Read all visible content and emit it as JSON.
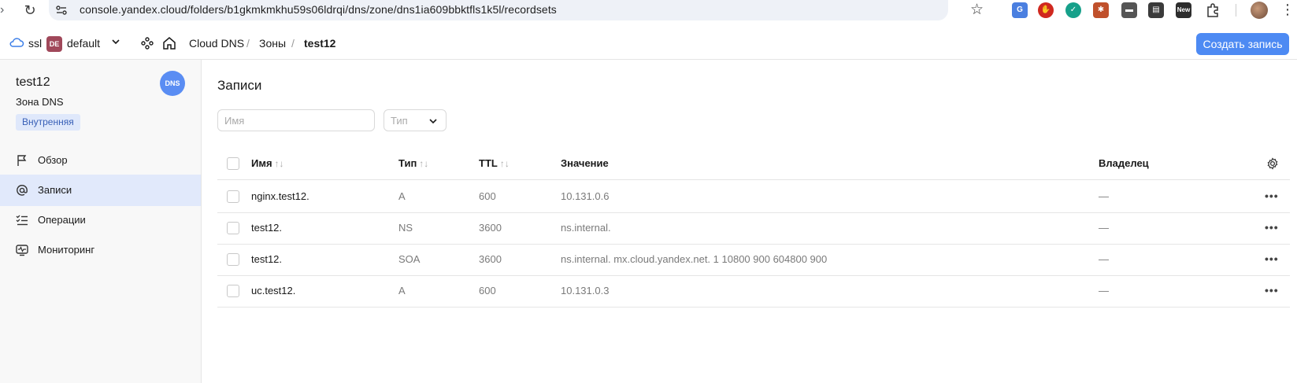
{
  "browser": {
    "url": "console.yandex.cloud/folders/b1gkmkmkhu59s06ldrqi/dns/zone/dns1ia609bbktfls1k5l/recordsets",
    "extensions": [
      {
        "name": "translate-extension-icon",
        "color": "#4a7fe0",
        "label": "G"
      },
      {
        "name": "adblock-extension-icon",
        "color": "#d0281f",
        "label": "✋"
      },
      {
        "name": "shield-extension-icon",
        "color": "#16a08a",
        "label": "✓"
      },
      {
        "name": "bug-extension-icon",
        "color": "#c0502b",
        "label": "✱"
      },
      {
        "name": "hat-extension-icon",
        "color": "#555555",
        "label": "▬"
      },
      {
        "name": "news-extension-icon",
        "color": "#3b3b3b",
        "label": "▤"
      },
      {
        "name": "new-extension-icon",
        "color": "#2d2d2d",
        "label": "New"
      }
    ]
  },
  "header": {
    "cloud_label": "ssl",
    "folder_badge": "DE",
    "folder_label": "default",
    "breadcrumbs": [
      "Cloud DNS",
      "Зоны",
      "test12"
    ],
    "create_button": "Создать запись"
  },
  "sidebar": {
    "zone_name": "test12",
    "zone_type": "Зона DNS",
    "zone_badge": "Внутренняя",
    "avatar": "DNS",
    "items": [
      {
        "label": "Обзор",
        "icon": "flag-icon"
      },
      {
        "label": "Записи",
        "icon": "at-icon",
        "active": true
      },
      {
        "label": "Операции",
        "icon": "checklist-icon"
      },
      {
        "label": "Мониторинг",
        "icon": "monitor-icon"
      }
    ]
  },
  "main": {
    "title": "Записи",
    "name_placeholder": "Имя",
    "type_placeholder": "Тип",
    "columns": {
      "name": "Имя",
      "type": "Тип",
      "ttl": "TTL",
      "value": "Значение",
      "owner": "Владелец"
    },
    "sort_glyph": "↑↓",
    "rows": [
      {
        "name": "nginx.test12.",
        "type": "A",
        "ttl": "600",
        "value": "10.131.0.6",
        "owner": "—"
      },
      {
        "name": "test12.",
        "type": "NS",
        "ttl": "3600",
        "value": "ns.internal.",
        "owner": "—"
      },
      {
        "name": "test12.",
        "type": "SOA",
        "ttl": "3600",
        "value": "ns.internal. mx.cloud.yandex.net. 1 10800 900 604800 900",
        "owner": "—"
      },
      {
        "name": "uc.test12.",
        "type": "A",
        "ttl": "600",
        "value": "10.131.0.3",
        "owner": "—"
      }
    ],
    "row_menu": "•••"
  },
  "colors": {
    "accent": "#4d8af3",
    "active_nav": "#e1e9fb",
    "badge_bg": "#dfe8fb",
    "badge_text": "#3960b7"
  }
}
